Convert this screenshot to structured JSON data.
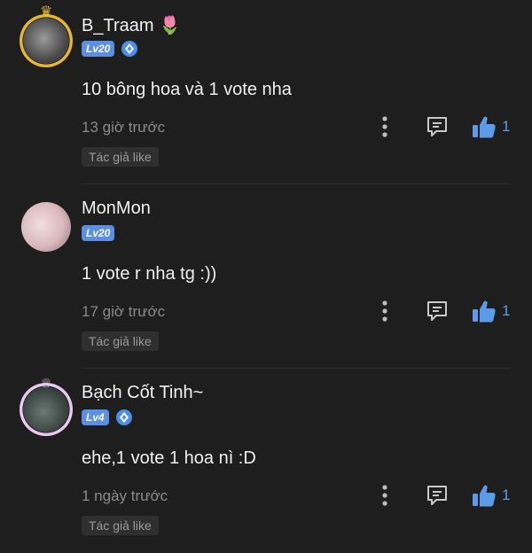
{
  "comments": [
    {
      "username": "B_Traam",
      "username_emoji": "🌷",
      "level": "Lv20",
      "verified": true,
      "text": "10 bông hoa và 1 vote nha",
      "time": "13 giờ trước",
      "like_count": "1",
      "author_like": "Tác giả like",
      "frame": "gold-crown"
    },
    {
      "username": "MonMon",
      "username_emoji": "",
      "level": "Lv20",
      "verified": false,
      "text": "1 vote r nha tg :))",
      "time": "17 giờ trước",
      "like_count": "1",
      "author_like": "Tác giả like",
      "frame": "none"
    },
    {
      "username": "Bạch Cốt Tinh~",
      "username_emoji": "",
      "level": "Lv4",
      "verified": true,
      "text": "ehe,1 vote 1 hoa nì :D",
      "time": "1 ngày trước",
      "like_count": "1",
      "author_like": "Tác giả like",
      "frame": "pink-floral"
    }
  ],
  "colors": {
    "background": "#1e1e1e",
    "accent_blue": "#5b9be8",
    "level_badge": "#5b8fe3",
    "muted_text": "#8a8a8a"
  },
  "icons": {
    "more": "more-vertical-icon",
    "reply": "reply-icon",
    "like": "thumbs-up-icon",
    "verify": "verified-icon"
  }
}
